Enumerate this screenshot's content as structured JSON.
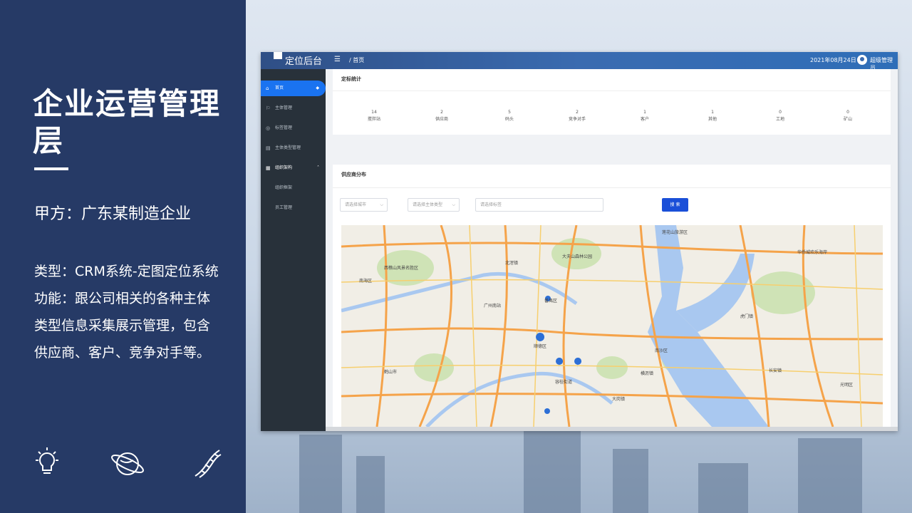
{
  "slide": {
    "title": "企业运营管理层",
    "client": "甲方：广东某制造企业",
    "type_line": "类型：CRM系统-定图定位系统",
    "function_line": "功能：跟公司相关的各种主体类型信息采集展示管理，包含供应商、客户、竞争对手等。",
    "icons": [
      "lightbulb-icon",
      "planet-icon",
      "dna-icon"
    ]
  },
  "app": {
    "logo_text": "定位后台",
    "breadcrumb": "/ 首页",
    "date": "2021年08月24日",
    "user": "超级管理员",
    "accent": "#1a73f0",
    "sidebar": {
      "items": [
        {
          "label": "首页",
          "icon": "home-icon",
          "active": true
        },
        {
          "label": "主体管理",
          "icon": "flag-icon"
        },
        {
          "label": "标签管理",
          "icon": "tag-icon"
        },
        {
          "label": "主体类型管理",
          "icon": "doc-icon"
        },
        {
          "label": "组织架构",
          "icon": "org-icon"
        },
        {
          "label": "组织框架",
          "icon": ""
        },
        {
          "label": "员工管理",
          "icon": ""
        }
      ]
    },
    "stats": {
      "title": "定标统计",
      "items": [
        {
          "value": "14",
          "label": "搅拌站"
        },
        {
          "value": "2",
          "label": "供应商"
        },
        {
          "value": "5",
          "label": "码头"
        },
        {
          "value": "2",
          "label": "竞争对手"
        },
        {
          "value": "1",
          "label": "客户"
        },
        {
          "value": "1",
          "label": "其他"
        },
        {
          "value": "0",
          "label": "工地"
        },
        {
          "value": "0",
          "label": "矿山"
        }
      ]
    },
    "supplier": {
      "title": "供应商分布",
      "city_placeholder": "请选择城市",
      "type_placeholder": "请选择主体类型",
      "tag_placeholder": "请选择标签",
      "search_label": "搜 索"
    },
    "map": {
      "labels": [
        "番禺区",
        "顺德区",
        "南沙区",
        "广州南站",
        "大夫山森林公园",
        "莲花山旅游区",
        "容桂街道",
        "大岗镇",
        "横沥镇",
        "虎门镇",
        "长安镇",
        "光明区",
        "鹤山市",
        "西樵山风景名胜区",
        "南海区",
        "北滘镇",
        "华侨城欢乐海岸"
      ],
      "pin_count": 5
    }
  }
}
